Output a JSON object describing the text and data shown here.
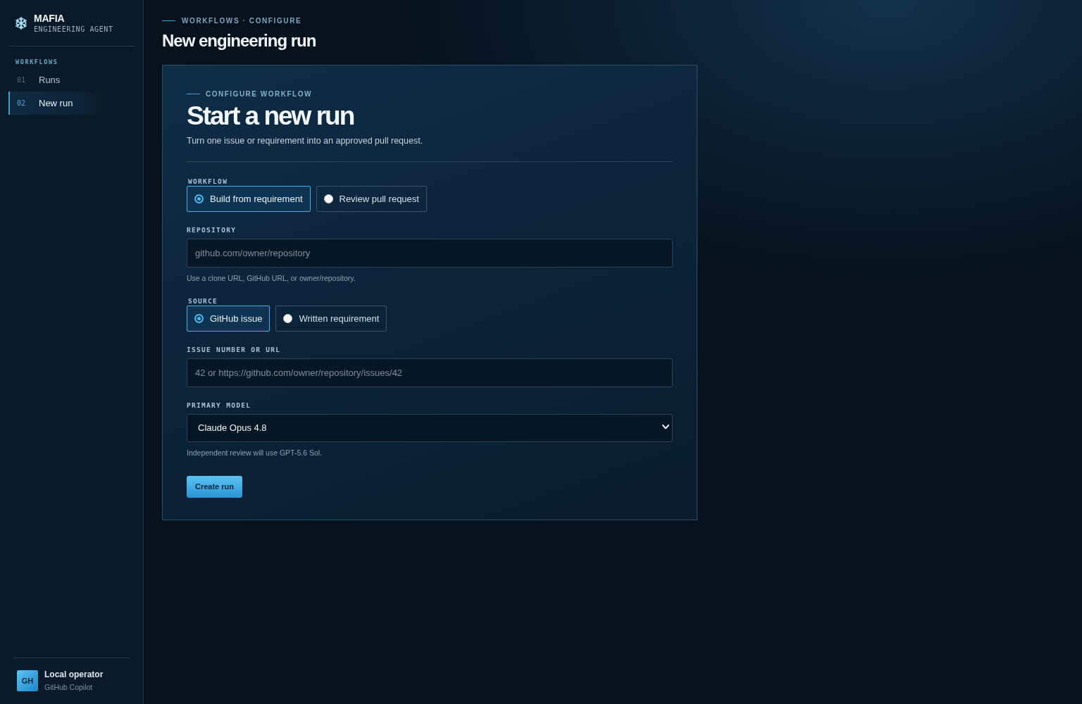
{
  "sidebar": {
    "brand": {
      "name": "MAFIA",
      "tagline": "ENGINEERING AGENT"
    },
    "section_label": "WORKFLOWS",
    "items": [
      {
        "number": "01",
        "label": "Runs",
        "selected": false
      },
      {
        "number": "02",
        "label": "New run",
        "selected": true
      }
    ],
    "user": {
      "avatar": "GH",
      "name": "Local operator",
      "subtitle": "GitHub Copilot"
    }
  },
  "header": {
    "breadcrumb": "WORKFLOWS · CONFIGURE",
    "title": "New engineering run"
  },
  "form": {
    "eyebrow": "CONFIGURE WORKFLOW",
    "title": "Start a new run",
    "description": "Turn one issue or requirement into an approved pull request.",
    "fields": [
      {
        "kind": "radio",
        "label": "WORKFLOW",
        "options": [
          {
            "label": "Build from requirement",
            "selected": true
          },
          {
            "label": "Review pull request",
            "selected": false
          }
        ]
      },
      {
        "kind": "text",
        "label": "REPOSITORY",
        "placeholder": "github.com/owner/repository",
        "help": "Use a clone URL, GitHub URL, or owner/repository."
      },
      {
        "kind": "radio",
        "label": "SOURCE",
        "options": [
          {
            "label": "GitHub issue",
            "selected": true
          },
          {
            "label": "Written requirement",
            "selected": false
          }
        ]
      },
      {
        "kind": "text",
        "label": "ISSUE NUMBER OR URL",
        "placeholder": "42 or https://github.com/owner/repository/issues/42"
      },
      {
        "kind": "select",
        "label": "PRIMARY MODEL",
        "value": "Claude Opus 4.8",
        "help": "Independent review will use GPT-5.6 Sol."
      }
    ],
    "submit": "Create run"
  }
}
